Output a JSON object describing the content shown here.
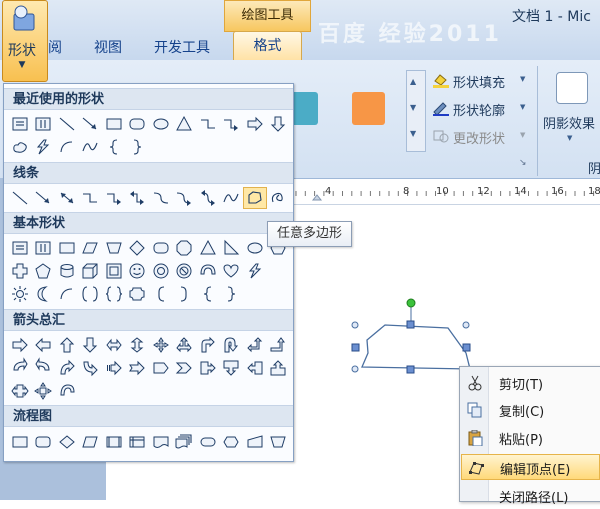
{
  "window": {
    "doc_title": "文档 1 - Mic",
    "context_tab_group": "绘图工具",
    "watermark": "百度 经验2011"
  },
  "tabs": [
    {
      "label": "阅"
    },
    {
      "label": "视图"
    },
    {
      "label": "开发工具"
    },
    {
      "label": "格式"
    }
  ],
  "shapes_button": {
    "label": "形状",
    "caret": "▼"
  },
  "ribbon": {
    "swatch_colors": [
      "#4bacc6",
      "#f79646"
    ],
    "fill_label": "形状填充",
    "outline_label": "形状轮廓",
    "change_label": "更改形状",
    "shadow_label": "阴影效果",
    "cut_off_label": "阴",
    "dropdown_caret": "▼"
  },
  "ruler": {
    "numbers": [
      "4",
      "8",
      "10",
      "12",
      "14",
      "16",
      "18"
    ]
  },
  "gallery": {
    "sections": [
      {
        "title": "最近使用的形状",
        "rows": [
          [
            "textbox",
            "vtextbox",
            "line",
            "arrow-line",
            "rect",
            "roundrect",
            "oval",
            "triangle",
            "elbow",
            "elbow-arrow",
            "right-arrow",
            "down-arrow"
          ],
          [
            "freeform-blob",
            "lightning",
            "arc",
            "curve",
            "left-brace",
            "right-brace"
          ]
        ]
      },
      {
        "title": "线条",
        "rows": [
          [
            "line",
            "arrow-line",
            "double-arrow-line",
            "elbow",
            "elbow-arrow",
            "elbow-double-arrow",
            "curved-connector",
            "curved-arrow",
            "curved-double-arrow",
            "curve",
            "freeform",
            "scribble"
          ]
        ]
      },
      {
        "title": "基本形状",
        "rows": [
          [
            "textbox",
            "vtextbox",
            "rect",
            "parallelogram",
            "trapezoid",
            "diamond",
            "roundrect",
            "octagon",
            "triangle",
            "right-triangle",
            "oval",
            "hexagon"
          ],
          [
            "cross",
            "pentagon",
            "can",
            "cube",
            "bevel",
            "smiley",
            "donut",
            "no-symbol",
            "block-arc",
            "heart",
            "lightning"
          ],
          [
            "sun",
            "moon",
            "arc",
            "brackets",
            "braces",
            "plaque",
            "left-bracket",
            "right-bracket",
            "left-brace",
            "right-brace"
          ]
        ]
      },
      {
        "title": "箭头总汇",
        "rows": [
          [
            "right-arrow",
            "left-arrow",
            "up-arrow",
            "down-arrow",
            "left-right-arrow",
            "up-down-arrow",
            "quad-arrow",
            "left-right-up-arrow",
            "bent-arrow",
            "u-turn-arrow",
            "left-up-arrow",
            "bent-up-arrow"
          ],
          [
            "curved-right-arrow",
            "curved-left-arrow",
            "curved-up-arrow",
            "curved-down-arrow",
            "striped-right-arrow",
            "notched-right-arrow",
            "pentagon-arrow",
            "chevron",
            "right-callout",
            "down-callout",
            "left-callout",
            "up-callout"
          ],
          [
            "left-right-callout",
            "quad-callout",
            "circular-arrow"
          ]
        ]
      },
      {
        "title": "流程图",
        "rows": [
          [
            "process",
            "alt-process",
            "decision",
            "data",
            "predefined",
            "internal-storage",
            "document",
            "multidocument",
            "terminator",
            "preparation",
            "manual-input",
            "manual-operation"
          ]
        ]
      }
    ],
    "hover_tooltip": "任意多边形"
  },
  "context_menu": {
    "items": [
      {
        "label": "剪切(T)",
        "icon": "scissors-icon"
      },
      {
        "label": "复制(C)",
        "icon": "copy-icon"
      },
      {
        "label": "粘贴(P)",
        "icon": "paste-icon"
      },
      {
        "label": "编辑顶点(E)",
        "icon": "edit-points-icon",
        "highlighted": true
      },
      {
        "label": "关闭路径(L)",
        "icon": "none"
      }
    ]
  }
}
